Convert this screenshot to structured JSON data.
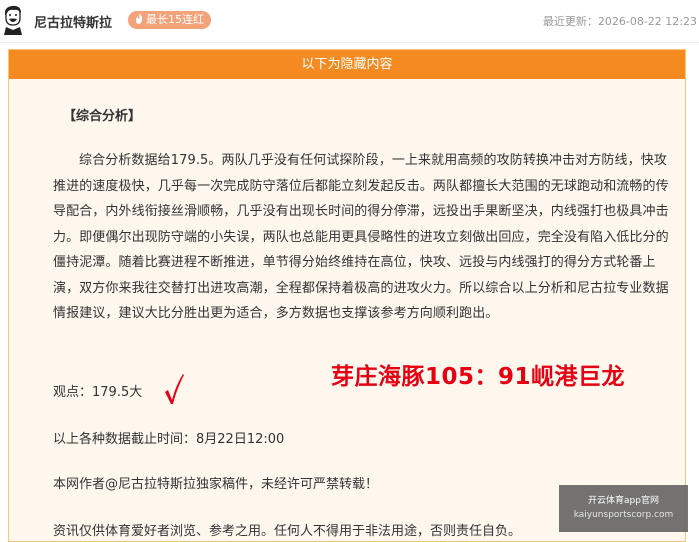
{
  "header": {
    "author": "尼古拉特斯拉",
    "streak_badge": "最长15连红",
    "last_update": "最近更新：2026-08-22 12:23"
  },
  "panel": {
    "banner": "以下为隐藏内容",
    "section_title": "【综合分析】",
    "analysis": "综合分析数据给179.5。两队几乎没有任何试探阶段，一上来就用高频的攻防转换冲击对方防线，快攻推进的速度极快，几乎每一次完成防守落位后都能立刻发起反击。两队都擅长大范围的无球跑动和流畅的传导配合，内外线衔接丝滑顺畅，几乎没有出现长时间的得分停滞，远投出手果断坚决，内线强打也极具冲击力。即便偶尔出现防守端的小失误，两队也总能用更具侵略性的进攻立刻做出回应，完全没有陷入低比分的僵持泥潭。随着比赛进程不断推进，单节得分始终维持在高位，快攻、远投与内线强打的得分方式轮番上演，双方你来我往交替打出进攻高潮，全程都保持着极高的进攻火力。所以综合以上分析和尼古拉专业数据情报建议，建议大比分胜出更为适合，多方数据也支撑该参考方向顺利跑出。",
    "viewpoint": "观点：179.5大",
    "cutoff": "以上各种数据截止时间：8月22日12:00",
    "copyright": "本网作者@尼古拉特斯拉独家稿件，未经许可严禁转载！",
    "disclaimer": "资讯仅供体育爱好者浏览、参考之用。任何人不得用于非法用途，否则责任自负。",
    "result": "芽庄海豚105：91岘港巨龙"
  },
  "watermark": {
    "line1": "开云体育app官网",
    "line2": "kaiyunsportscorp.com"
  },
  "colors": {
    "banner": "#f58a20",
    "panel_bg": "#fdf7ee",
    "badge": "#f4a27a",
    "result": "#e60012",
    "check": "#e60012"
  },
  "icons": {
    "avatar": "avatar-portrait-icon",
    "badge": "flame-icon",
    "verdict": "red-checkmark-icon"
  }
}
